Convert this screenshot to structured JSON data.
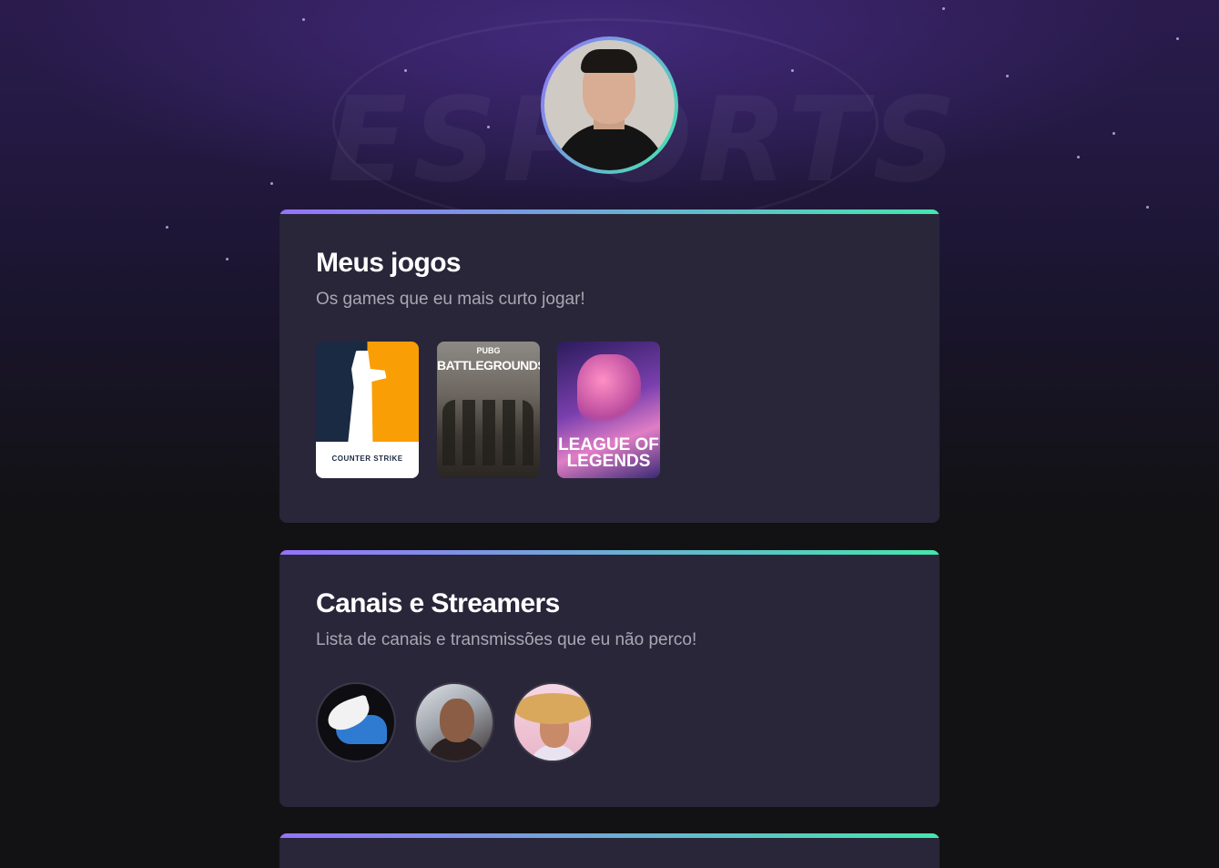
{
  "profile": {
    "avatar_icon": "profile-avatar"
  },
  "background": {
    "watermark": "ESPORTS"
  },
  "games_section": {
    "title": "Meus jogos",
    "subtitle": "Os games que eu mais curto jogar!",
    "games": [
      {
        "name": "Counter-Strike",
        "logo_text": "COUNTER STRIKE",
        "icon": "counter-strike-cover"
      },
      {
        "name": "PUBG Battlegrounds",
        "logo_line1": "PUBG",
        "logo_line2": "BATTLEGROUNDS",
        "icon": "pubg-cover"
      },
      {
        "name": "League of Legends",
        "logo_line1": "LEAGUE OF",
        "logo_line2": "LEGENDS",
        "icon": "lol-cover"
      }
    ]
  },
  "streamers_section": {
    "title": "Canais e Streamers",
    "subtitle": "Lista de canais e transmissões que eu não perco!",
    "channels": [
      {
        "icon": "winged-helmet-avatar"
      },
      {
        "icon": "streamer-avatar"
      },
      {
        "icon": "streamer-avatar"
      }
    ]
  },
  "colors": {
    "accent_start": "#9572fc",
    "accent_end": "#43e7ad",
    "card_bg": "#29263a",
    "page_bg": "#121214"
  }
}
